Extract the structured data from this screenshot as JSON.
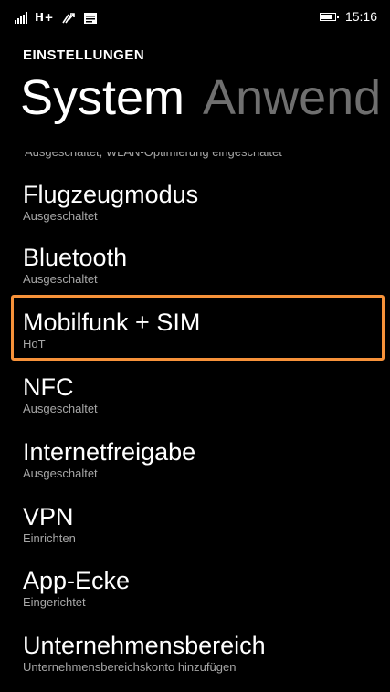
{
  "status_bar": {
    "network": "H+",
    "time": "15:16",
    "icons": [
      "signal-icon",
      "network-type",
      "data-sync-icon",
      "message-icon",
      "battery-icon"
    ]
  },
  "header": {
    "app_title": "EINSTELLUNGEN",
    "pivots": [
      {
        "label": "System",
        "active": true
      },
      {
        "label": "Anwend",
        "active": false
      }
    ]
  },
  "list": {
    "cutoff_subtitle": "Ausgeschaltet, WLAN-Optimierung eingeschaltet",
    "items": [
      {
        "title": "Flugzeugmodus",
        "subtitle": "Ausgeschaltet"
      },
      {
        "title": "Bluetooth",
        "subtitle": "Ausgeschaltet"
      },
      {
        "title": "Mobilfunk + SIM",
        "subtitle": "HoT",
        "highlighted": true
      },
      {
        "title": "NFC",
        "subtitle": "Ausgeschaltet"
      },
      {
        "title": "Internetfreigabe",
        "subtitle": "Ausgeschaltet"
      },
      {
        "title": "VPN",
        "subtitle": "Einrichten"
      },
      {
        "title": "App-Ecke",
        "subtitle": "Eingerichtet"
      },
      {
        "title": "Unternehmensbereich",
        "subtitle": "Unternehmensbereichskonto hinzufügen"
      }
    ]
  },
  "colors": {
    "background": "#000000",
    "text_primary": "#ffffff",
    "text_secondary": "#a6a6a6",
    "pivot_inactive": "#6f6f6f",
    "highlight_border": "#f7923a"
  }
}
